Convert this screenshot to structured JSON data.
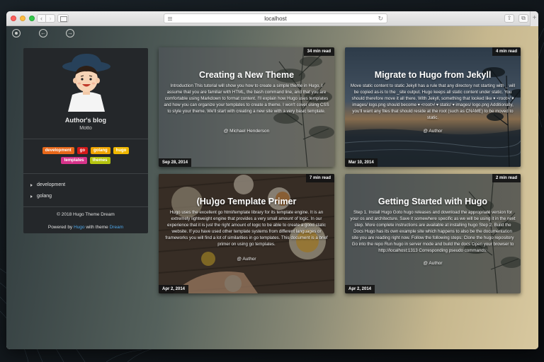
{
  "browser": {
    "url": "localhost",
    "back_symbol": "‹",
    "forward_symbol": "›",
    "reload_symbol": "↻",
    "share_symbol": "⇧",
    "tabs_symbol": "⧉",
    "new_tab_symbol": "+"
  },
  "topnav": {
    "back_symbol": "←",
    "forward_symbol": "→"
  },
  "sidebar": {
    "title": "Author's blog",
    "motto": "Motto",
    "tags": [
      {
        "label": "development",
        "color": "#e8681a"
      },
      {
        "label": "go",
        "color": "#d41a1a"
      },
      {
        "label": "golang",
        "color": "#f0a500"
      },
      {
        "label": "hugo",
        "color": "#f0b800"
      },
      {
        "label": "templates",
        "color": "#d6338a"
      },
      {
        "label": "themes",
        "color": "#b5c40f"
      }
    ],
    "categories": [
      "development",
      "golang"
    ],
    "copyright": "© 2018 Hugo Theme Dream",
    "powered_prefix": "Powered by",
    "powered_link": "Hugo",
    "powered_middle": "with theme",
    "theme_link": "Dream"
  },
  "posts": [
    {
      "title": "Creating a New Theme",
      "read_time": "34 min read",
      "date": "Sep 28, 2014",
      "author": "@ Michael Henderson",
      "excerpt": "Introduction This tutorial will show you how to create a simple theme in Hugo. I assume that you are familiar with HTML, the bash command line, and that you are comfortable using Markdown to format content. I'll explain how Hugo uses templates and how you can organize your templates to create a theme. I won't cover using CSS to style your theme. We'll start with creating a new site with a very basic template."
    },
    {
      "title": "Migrate to Hugo from Jekyll",
      "read_time": "4 min read",
      "date": "Mar 10, 2014",
      "author": "@ Author",
      "excerpt": "Move static content to static Jekyll has a rule that any directory not starting with _ will be copied as-is to the _site output. Hugo keeps all static content under static. You should therefore move it all there. With Jekyll, something that looked like ▾ <root>/ ▾ images/ logo.png should become ▾ <root>/ ▾ static/ ▾ images/ logo.png Additionally, you'll want any files that should reside at the root (such as CNAME) to be moved to static."
    },
    {
      "title": "(Hu)go Template Primer",
      "read_time": "7 min read",
      "date": "Apr 2, 2014",
      "author": "@ Author",
      "excerpt": "Hugo uses the excellent go html/template library for its template engine. It is an extremely lightweight engine that provides a very small amount of logic. In our experience that it is just the right amount of logic to be able to create a good static website. If you have used other template systems from different languages or frameworks you will find a lot of similarities in go templates. This document is a brief primer on using go templates."
    },
    {
      "title": "Getting Started with Hugo",
      "read_time": "2 min read",
      "date": "Apr 2, 2014",
      "author": "@ Author",
      "excerpt": "Step 1. Install Hugo Goto hugo releases and download the appropriate version for your os and architecture. Save it somewhere specific as we will be using it in the next step. More complete instructions are available at installing hugo Step 2. Build the Docs Hugo has its own example site which happens to also be the documentation site you are reading right now. Follow the following steps: Clone the hugo repository Go into the repo Run hugo in server mode and build the docs Open your browser to http://localhost:1313 Corresponding pseudo commands:"
    }
  ]
}
